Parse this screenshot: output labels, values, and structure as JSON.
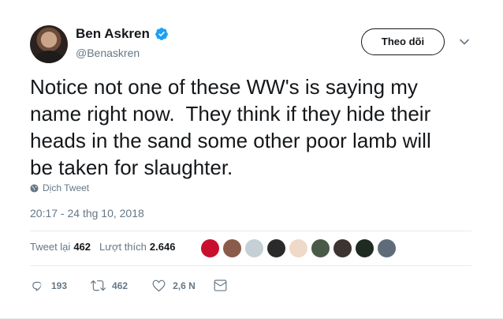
{
  "author": {
    "display_name": "Ben Askren",
    "handle": "@Benaskren",
    "verified": true
  },
  "follow_button": "Theo dõi",
  "tweet": {
    "text": "Notice not one of these WW's is saying my\nname right now.  They think if they hide their\nheads in the sand some other poor lamb will\nbe taken for slaughter.",
    "translate_label": "Dịch Tweet",
    "timestamp": "20:17 - 24 thg 10, 2018"
  },
  "stats": {
    "retweets_label": "Tweet lại",
    "retweets_count": "462",
    "likes_label": "Lượt thích",
    "likes_count": "2.646"
  },
  "actions": {
    "reply_count": "193",
    "retweet_count": "462",
    "like_count": "2,6 N"
  },
  "liker_avatars": [
    {
      "color": "#c8102e"
    },
    {
      "color": "#8a5a4a"
    },
    {
      "color": "#c5cfd6"
    },
    {
      "color": "#2a2a2a"
    },
    {
      "color": "#efd9c8"
    },
    {
      "color": "#4a5a48"
    },
    {
      "color": "#3b3430"
    },
    {
      "color": "#1f2a22"
    },
    {
      "color": "#5e6c7a"
    }
  ],
  "colors": {
    "verified_blue": "#1da1f2",
    "text_primary": "#14171a",
    "text_secondary": "#657786"
  },
  "icons": [
    "verified-badge-icon",
    "chevron-down-icon",
    "globe-icon",
    "reply-icon",
    "retweet-icon",
    "heart-icon",
    "message-icon"
  ]
}
